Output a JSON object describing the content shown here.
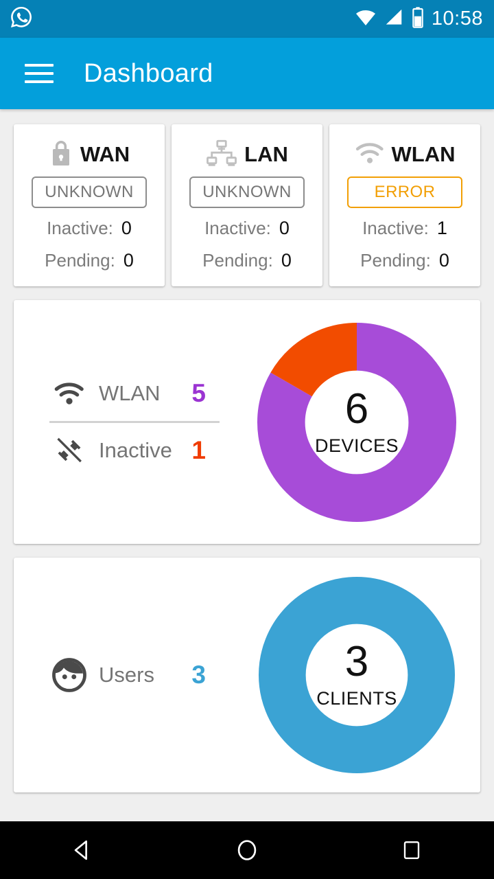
{
  "status_bar": {
    "app_icon": "whatsapp-icon",
    "wifi_icon": "wifi-icon",
    "signal_icon": "cell-signal-icon",
    "battery_icon": "battery-icon",
    "time": "10:58"
  },
  "app_bar": {
    "menu_icon": "hamburger-menu-icon",
    "title": "Dashboard"
  },
  "status_cards": [
    {
      "icon": "lock-icon",
      "title": "WAN",
      "badge": "UNKNOWN",
      "badge_state": "unknown",
      "rows": [
        {
          "label": "Inactive:",
          "value": "0"
        },
        {
          "label": "Pending:",
          "value": "0"
        }
      ]
    },
    {
      "icon": "sitemap-icon",
      "title": "LAN",
      "badge": "UNKNOWN",
      "badge_state": "unknown",
      "rows": [
        {
          "label": "Inactive:",
          "value": "0"
        },
        {
          "label": "Pending:",
          "value": "0"
        }
      ]
    },
    {
      "icon": "wifi-icon",
      "title": "WLAN",
      "badge": "ERROR",
      "badge_state": "error",
      "rows": [
        {
          "label": "Inactive:",
          "value": "1"
        },
        {
          "label": "Pending:",
          "value": "0"
        }
      ]
    }
  ],
  "devices_card": {
    "legend": [
      {
        "icon": "wifi-icon",
        "label": "WLAN",
        "value": "5",
        "color": "#9b34d2"
      },
      {
        "icon": "plug-disconnected-icon",
        "label": "Inactive",
        "value": "1",
        "color": "#f03c02"
      }
    ],
    "donut": {
      "center_number": "6",
      "center_caption": "DEVICES"
    }
  },
  "clients_card": {
    "legend": [
      {
        "icon": "user-face-icon",
        "label": "Users",
        "value": "3",
        "color": "#3ba3d4"
      }
    ],
    "donut": {
      "center_number": "3",
      "center_caption": "CLIENTS"
    }
  },
  "nav_bar": {
    "back_icon": "back-triangle-icon",
    "home_icon": "home-circle-icon",
    "recents_icon": "recents-square-icon"
  },
  "colors": {
    "status_bar": "#0581b6",
    "app_bar": "#039fdb",
    "page_background": "#efefef",
    "purple": "#a74cd8",
    "orange_red": "#f24c00",
    "blue": "#3ba3d4",
    "badge_error": "#f29f05",
    "badge_unknown": "#8d8d8d"
  },
  "chart_data": [
    {
      "type": "pie",
      "title": "DEVICES",
      "total": 6,
      "categories": [
        "WLAN",
        "Inactive"
      ],
      "values": [
        5,
        1
      ],
      "colors": [
        "#a74cd8",
        "#f24c00"
      ],
      "center_label": "6",
      "center_sublabel": "DEVICES",
      "legend": "left",
      "donut": true
    },
    {
      "type": "pie",
      "title": "CLIENTS",
      "total": 3,
      "categories": [
        "Users"
      ],
      "values": [
        3
      ],
      "colors": [
        "#3ba3d4"
      ],
      "center_label": "3",
      "center_sublabel": "CLIENTS",
      "legend": "left",
      "donut": true
    }
  ]
}
